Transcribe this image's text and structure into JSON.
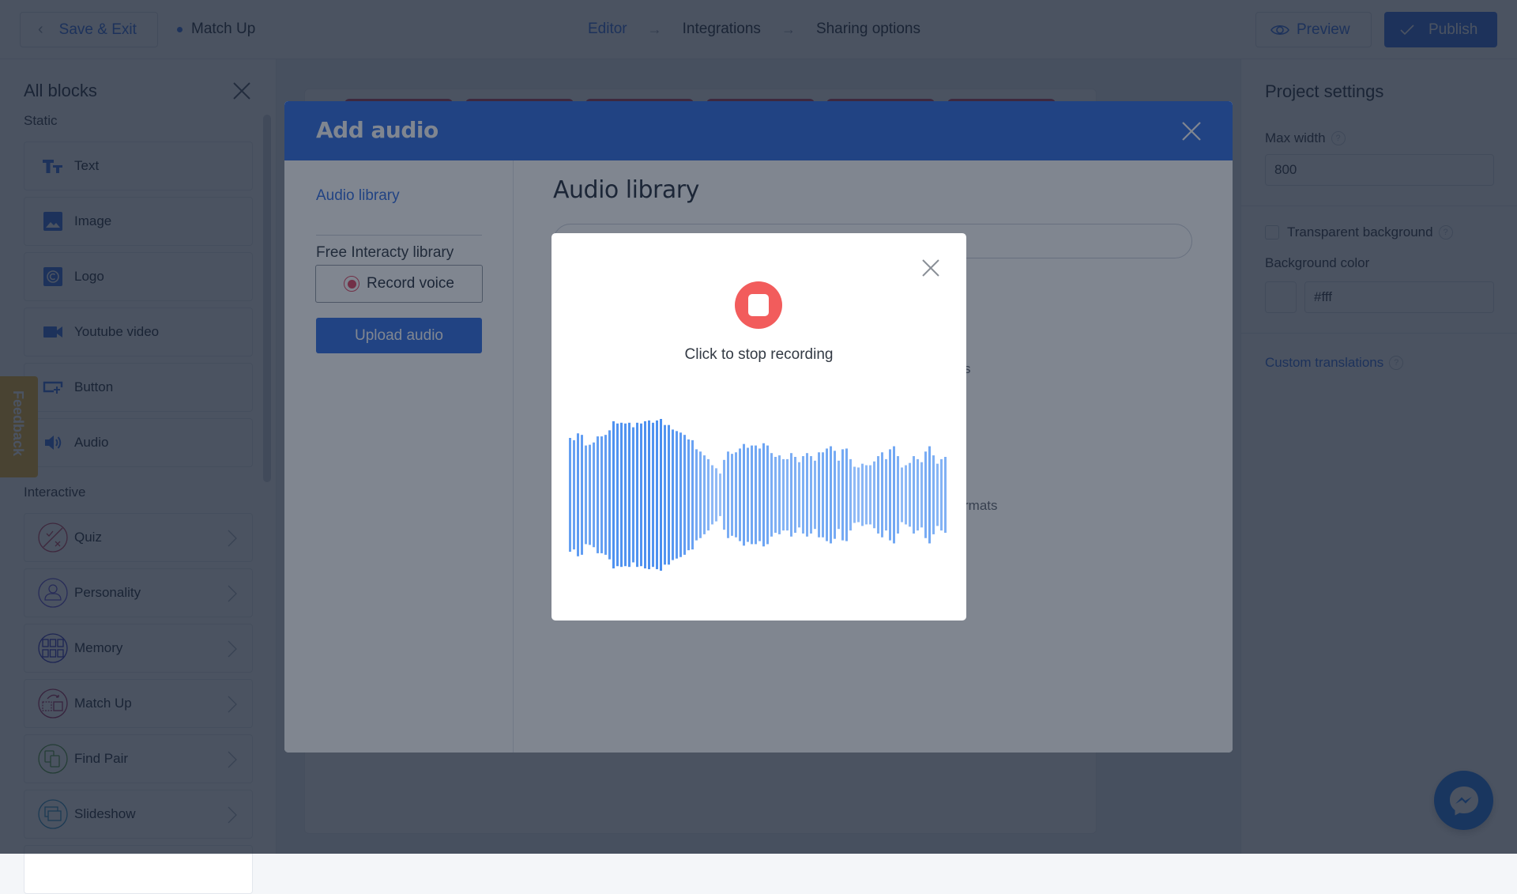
{
  "topbar": {
    "save_exit_label": "Save & Exit",
    "project_name": "Match Up",
    "steps": [
      "Editor",
      "Integrations",
      "Sharing options"
    ],
    "active_step": "Editor",
    "preview_label": "Preview",
    "publish_label": "Publish"
  },
  "sidebar": {
    "title": "All blocks",
    "static_label": "Static",
    "static_items": [
      {
        "label": "Text",
        "icon": "text-format-icon"
      },
      {
        "label": "Image",
        "icon": "image-icon"
      },
      {
        "label": "Logo",
        "icon": "logo-icon"
      },
      {
        "label": "Youtube video",
        "icon": "video-camera-icon"
      },
      {
        "label": "Button",
        "icon": "button-click-icon"
      },
      {
        "label": "Audio",
        "icon": "speaker-icon"
      }
    ],
    "interactive_label": "Interactive",
    "interactive_items": [
      {
        "label": "Quiz",
        "icon": "quiz-icon",
        "color": "#c43b5d"
      },
      {
        "label": "Personality",
        "icon": "person-icon",
        "color": "#5b4bd6"
      },
      {
        "label": "Memory",
        "icon": "memory-grid-icon",
        "color": "#2f2fbf"
      },
      {
        "label": "Match Up",
        "icon": "match-up-icon",
        "color": "#a3245a"
      },
      {
        "label": "Find Pair",
        "icon": "find-pair-icon",
        "color": "#4f9b3a"
      },
      {
        "label": "Slideshow",
        "icon": "slideshow-icon",
        "color": "#2a8fc0"
      }
    ]
  },
  "feedback_label": "Feedback",
  "project_settings": {
    "title": "Project settings",
    "max_width_label": "Max width",
    "max_width_value": "800",
    "transparent_bg_label": "Transparent background",
    "transparent_bg_checked": false,
    "bg_color_label": "Background color",
    "bg_color_value": "#fff",
    "custom_translations_label": "Custom translations"
  },
  "add_audio_modal": {
    "title": "Add audio",
    "nav": [
      {
        "label": "Audio library",
        "active": true
      },
      {
        "label": "Free Interacty library",
        "active": false
      }
    ],
    "record_voice_label": "Record voice",
    "upload_audio_label": "Upload audio",
    "main_title": "Audio library",
    "search_placeholder": "",
    "partial_text_1": "s",
    "partial_text_2": "rmats"
  },
  "recording_popup": {
    "status_text": "Click to stop recording",
    "waveform_color": "#4a8ff0",
    "waveform_amplitudes": [
      0.75,
      0.72,
      0.81,
      0.79,
      0.65,
      0.66,
      0.69,
      0.77,
      0.77,
      0.79,
      0.85,
      0.97,
      0.94,
      0.95,
      0.94,
      0.95,
      0.89,
      0.95,
      0.94,
      0.97,
      0.98,
      0.95,
      0.98,
      1.0,
      0.92,
      0.92,
      0.86,
      0.84,
      0.82,
      0.79,
      0.73,
      0.72,
      0.6,
      0.57,
      0.52,
      0.47,
      0.39,
      0.35,
      0.28,
      0.46,
      0.57,
      0.54,
      0.56,
      0.61,
      0.67,
      0.62,
      0.65,
      0.65,
      0.61,
      0.68,
      0.65,
      0.55,
      0.5,
      0.52,
      0.47,
      0.47,
      0.55,
      0.5,
      0.43,
      0.51,
      0.55,
      0.51,
      0.45,
      0.56,
      0.56,
      0.61,
      0.64,
      0.58,
      0.45,
      0.6,
      0.61,
      0.47,
      0.37,
      0.36,
      0.41,
      0.39,
      0.39,
      0.44,
      0.51,
      0.56,
      0.47,
      0.6,
      0.64,
      0.51,
      0.36,
      0.39,
      0.42,
      0.51,
      0.47,
      0.43,
      0.57,
      0.64,
      0.52,
      0.41,
      0.47,
      0.5
    ]
  },
  "canvas_tab_count": 6
}
